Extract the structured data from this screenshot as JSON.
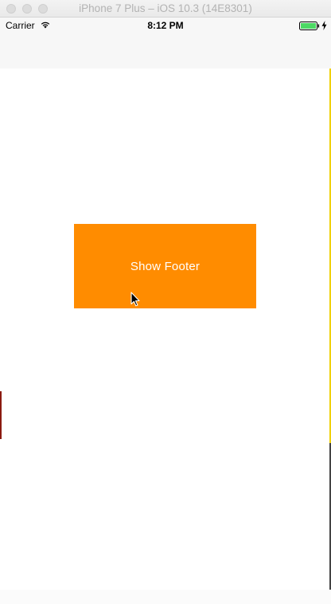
{
  "window": {
    "title": "iPhone 7 Plus – iOS 10.3 (14E8301)"
  },
  "status_bar": {
    "carrier": "Carrier",
    "time": "8:12 PM",
    "battery_color": "#4cd964"
  },
  "main": {
    "show_footer_label": "Show Footer",
    "button_color": "#ff8c00"
  }
}
